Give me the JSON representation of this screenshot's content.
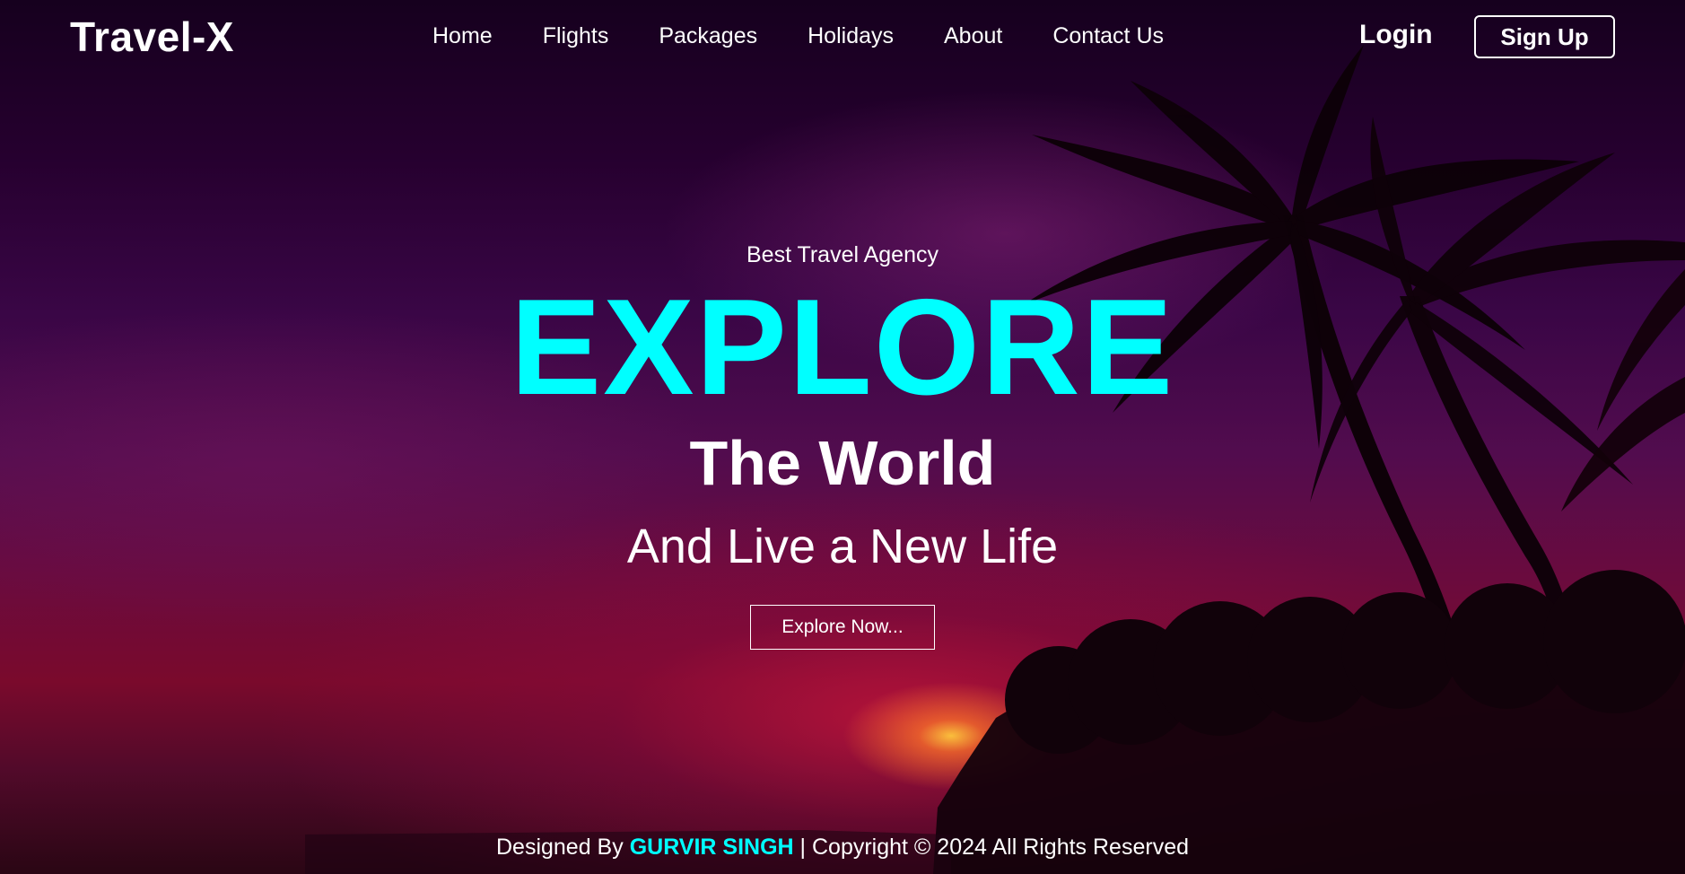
{
  "header": {
    "logo": "Travel-X",
    "nav": [
      {
        "label": "Home"
      },
      {
        "label": "Flights"
      },
      {
        "label": "Packages"
      },
      {
        "label": "Holidays"
      },
      {
        "label": "About"
      },
      {
        "label": "Contact Us"
      }
    ],
    "login_label": "Login",
    "signup_label": "Sign Up"
  },
  "hero": {
    "tagline": "Best Travel Agency",
    "headline": "EXPLORE",
    "subheadline": "The World",
    "line3": "And Live a New Life",
    "cta_label": "Explore Now..."
  },
  "footer": {
    "prefix": "Designed By ",
    "author": "GURVIR SINGH",
    "suffix": " | Copyright © 2024 All Rights Reserved"
  },
  "colors": {
    "accent": "#00ffff",
    "text": "#ffffff"
  }
}
